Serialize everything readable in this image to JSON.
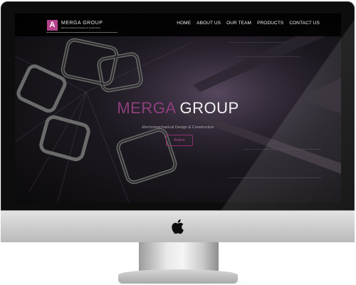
{
  "site": {
    "brand": {
      "logo_glyph": "A",
      "name": "MERGA  GROUP",
      "tagline": "Electromechanical Design & Construction"
    },
    "nav": [
      {
        "label": "HOME"
      },
      {
        "label": "ABOUT US"
      },
      {
        "label": "OUR TEAM"
      },
      {
        "label": "PRODUCTS"
      },
      {
        "label": "CONTACT US"
      }
    ],
    "hero": {
      "title_part1": "MERGA",
      "title_part2": "GROUP",
      "subtitle": "Electromechanical Design & Construction",
      "button_label": "Action"
    }
  },
  "colors": {
    "accent": "#8e3f7d",
    "logo_bg": "#b5438c",
    "screen_bg": "#1e1a22",
    "chin": "#d0d0d0"
  },
  "icons": {
    "device_logo": "apple-icon"
  }
}
